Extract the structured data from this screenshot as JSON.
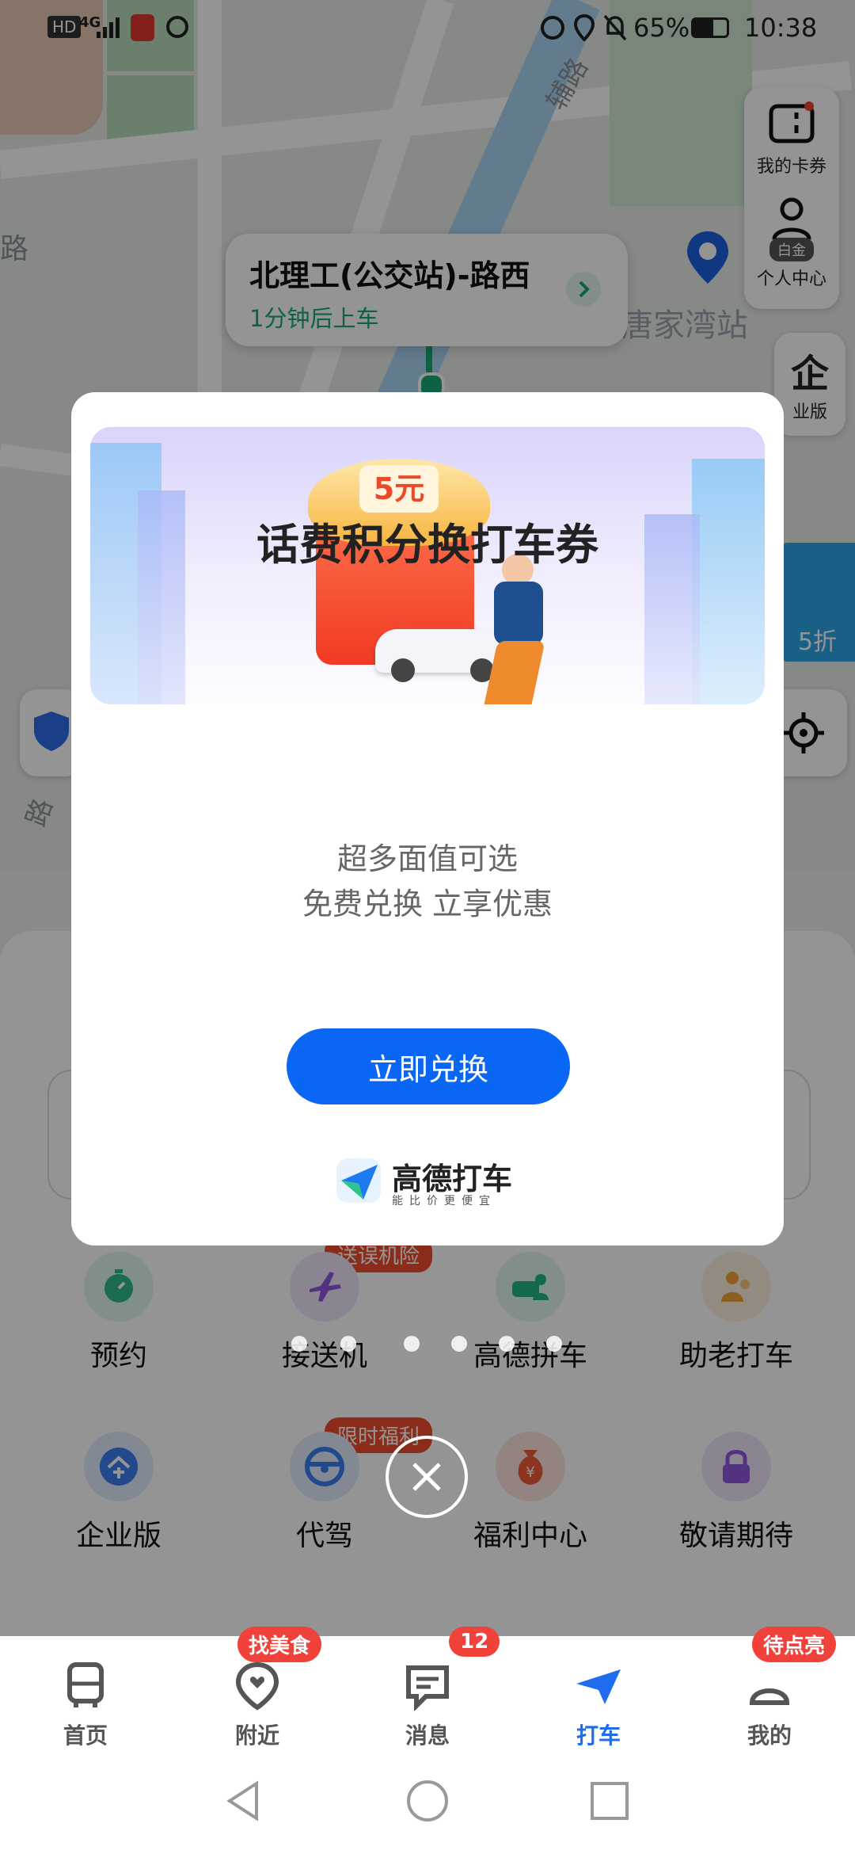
{
  "status_bar": {
    "network": "HD",
    "signal": "4G",
    "battery": "65%",
    "time": "10:38"
  },
  "map": {
    "road_label_1": "路",
    "road_label_2": "辅路",
    "road_label_3": "路",
    "station_label": "唐家湾站",
    "pickup": {
      "title": "北理工(公交站)-路西",
      "subtitle": "1分钟后上车"
    },
    "right_buttons": {
      "cards": "我的卡券",
      "personal_badge": "白金",
      "personal": "个人中心",
      "enterprise_icon": "企",
      "enterprise": "业版"
    },
    "side_ad_text": "5折"
  },
  "panel": {
    "services_row1": [
      {
        "label": "预约",
        "icon": "clock-icon",
        "color": "#2fb88a"
      },
      {
        "label": "接送机",
        "icon": "plane-icon",
        "color": "#8f56e0",
        "tag": "送误机险"
      },
      {
        "label": "高德拼车",
        "icon": "carpool-icon",
        "color": "#23b683"
      },
      {
        "label": "助老打车",
        "icon": "elderly-icon",
        "color": "#f2a33a"
      }
    ],
    "services_row2": [
      {
        "label": "企业版",
        "icon": "enterprise-icon",
        "color": "#3a7ef0"
      },
      {
        "label": "代驾",
        "icon": "steering-wheel-icon",
        "color": "#3a7ef0",
        "tag": "限时福利"
      },
      {
        "label": "福利中心",
        "icon": "money-bag-icon",
        "color": "#f05a3a"
      },
      {
        "label": "敬请期待",
        "icon": "lock-icon",
        "color": "#8f56e0"
      }
    ]
  },
  "modal": {
    "coupon_amount": "5元",
    "title": "话费积分换打车券",
    "line1": "超多面值可选",
    "line2": "免费兑换 立享优惠",
    "cta": "立即兑换",
    "brand": "高德打车",
    "brand_slogan": "能比价更便宜"
  },
  "tabs": [
    {
      "label": "首页",
      "icon": "bus-icon"
    },
    {
      "label": "附近",
      "icon": "location-heart-icon",
      "badge": "找美食"
    },
    {
      "label": "消息",
      "icon": "message-icon",
      "badge": "12"
    },
    {
      "label": "打车",
      "icon": "taxi-plane-icon",
      "active": true
    },
    {
      "label": "我的",
      "icon": "profile-icon",
      "badge": "待点亮"
    }
  ],
  "colors": {
    "accent": "#0a66f4",
    "badge": "#f0413a"
  }
}
